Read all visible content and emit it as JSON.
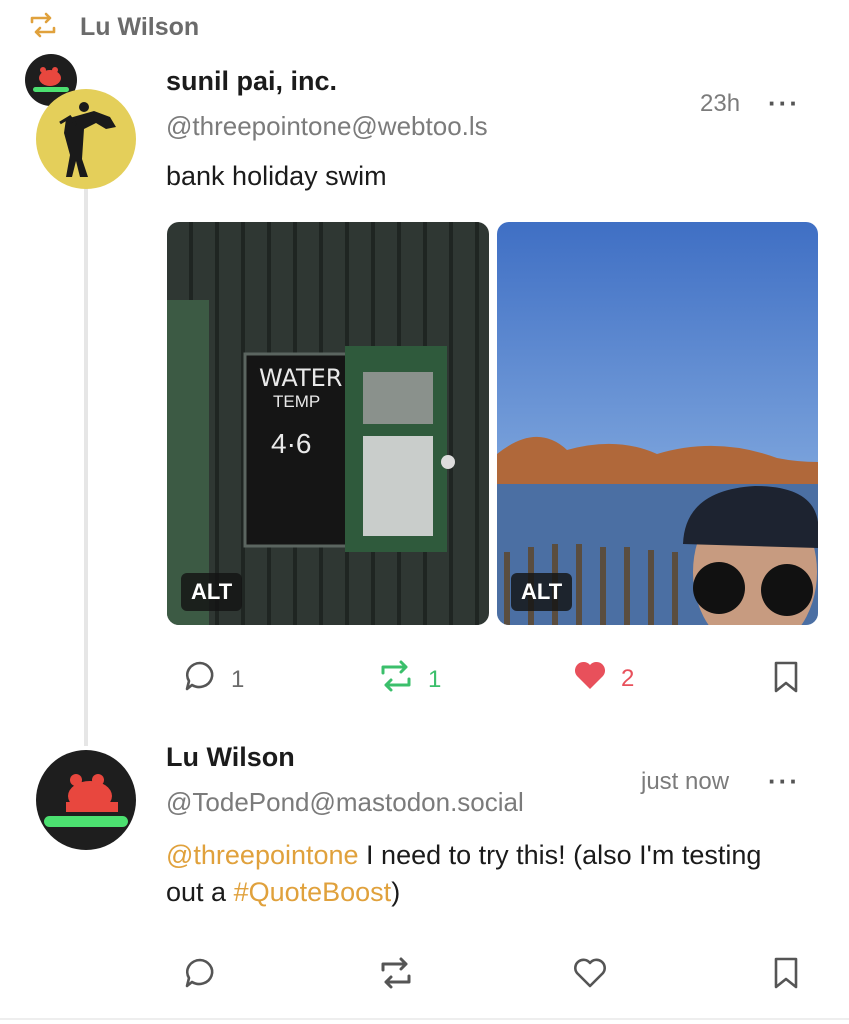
{
  "boost": {
    "label": "Lu Wilson",
    "icon": "boost-icon"
  },
  "post": {
    "author_name": "sunil pai, inc.",
    "handle": "@threepointone@webtoo.ls",
    "time": "23h",
    "more": "···",
    "text": "bank holiday swim",
    "media": [
      {
        "alt_label": "ALT",
        "sign_line1": "WATER",
        "sign_line2": "TEMP",
        "sign_value": "4·6"
      },
      {
        "alt_label": "ALT"
      }
    ],
    "actions": {
      "replies": "1",
      "boosts": "1",
      "likes": "2"
    },
    "colors": {
      "boosted": "#3bbf6b",
      "liked": "#e8505b"
    }
  },
  "reply": {
    "author_name": "Lu Wilson",
    "handle": "@TodePond@mastodon.social",
    "time": "just now",
    "more": "···",
    "mention": "@threepointone",
    "text_middle": " I need to try this! (also I'm testing out a ",
    "hashtag": "#QuoteBoost",
    "text_end": ")"
  },
  "accent_color": "#e0a13c"
}
